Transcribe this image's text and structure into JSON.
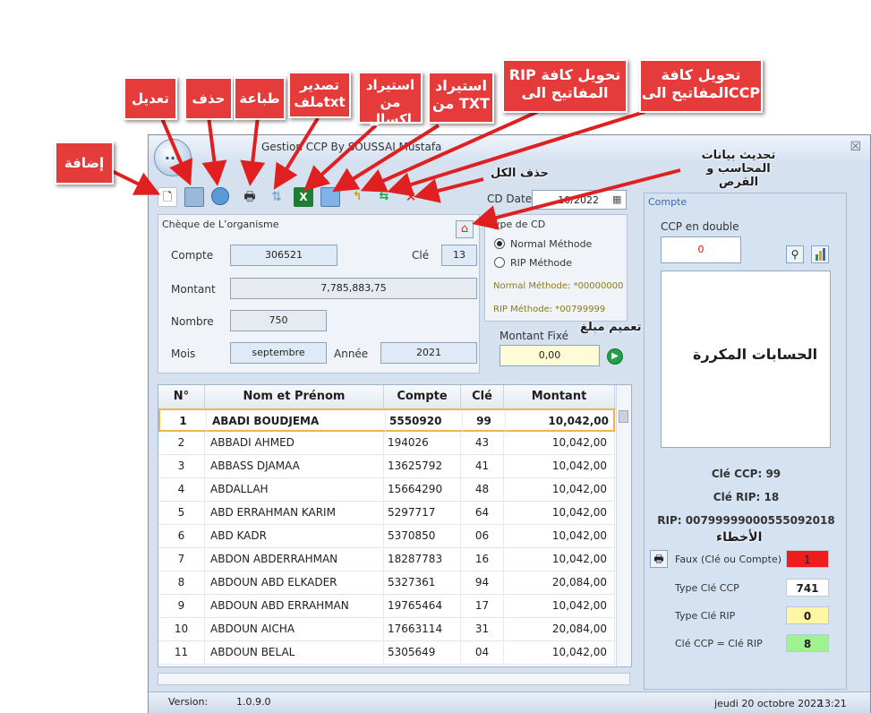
{
  "window": {
    "title": "Gestion CCP By SOUSSAI Mustafa",
    "orb_label": "...",
    "close_glyph": "☒"
  },
  "annotations": {
    "add": "إضافة",
    "edit": "تعديل",
    "delete": "حذف",
    "print": "طباعة",
    "export_txt": "تصدير ملفtxt",
    "import_excel": "استيراد من اكسال",
    "import_txt": "استيراد من TXT",
    "convert_rip": "RIP  تحويل كافة المفاتيح الى",
    "convert_ccp": "تحويل كافة المفاتيح الىCCP",
    "delete_all": "حذف الكل",
    "update_data": "تحديث بيانات المحاسب و القرص",
    "generalize_amount": "تعميم مبلغ",
    "duplicate_accounts": "الحسابات المكررة",
    "errors": "الأخطاء"
  },
  "toolbar": {
    "icons": [
      "new-document-icon",
      "edit-image-icon",
      "delete-icon",
      "print-icon",
      "export-txt-icon",
      "excel-icon",
      "import-txt-icon",
      "convert-rip-icon",
      "convert-ccp-icon",
      "delete-all-icon"
    ]
  },
  "cd_date": {
    "label": "CD Date",
    "value": "10/2022"
  },
  "cheque": {
    "section_title": "Chèque de L’organisme",
    "compte_label": "Compte",
    "compte_value": "306521",
    "cle_label": "Clé",
    "cle_value": "13",
    "montant_label": "Montant",
    "montant_value": "7,785,883,75",
    "nombre_label": "Nombre",
    "nombre_value": "750",
    "mois_label": "Mois",
    "mois_value": "septembre",
    "annee_label": "Année",
    "annee_value": "2021"
  },
  "type_cd": {
    "title": "Type de CD",
    "option_normal": "Normal Méthode",
    "option_rip": "RIP Méthode",
    "selected": "Normal Méthode",
    "normal_hint": "Normal Méthode: *00000000",
    "rip_hint": "RIP Méthode: *00799999"
  },
  "montant_fixe": {
    "label": "Montant Fixé",
    "value": "0,00"
  },
  "grid": {
    "columns": [
      "N°",
      "Nom et Prénom",
      "Compte",
      "Clé",
      "Montant"
    ],
    "rows": [
      {
        "n": "1",
        "nom": "ABADI BOUDJEMA",
        "compte": "5550920",
        "cle": "99",
        "montant": "10,042,00"
      },
      {
        "n": "2",
        "nom": "ABBADI AHMED",
        "compte": "194026",
        "cle": "43",
        "montant": "10,042,00"
      },
      {
        "n": "3",
        "nom": "ABBASS DJAMAA",
        "compte": "13625792",
        "cle": "41",
        "montant": "10,042,00"
      },
      {
        "n": "4",
        "nom": "ABDALLAH",
        "compte": "15664290",
        "cle": "48",
        "montant": "10,042,00"
      },
      {
        "n": "5",
        "nom": "ABD ERRAHMAN KARIM",
        "compte": "5297717",
        "cle": "64",
        "montant": "10,042,00"
      },
      {
        "n": "6",
        "nom": "ABD KADR",
        "compte": "5370850",
        "cle": "06",
        "montant": "10,042,00"
      },
      {
        "n": "7",
        "nom": "ABDON ABDERRAHMAN",
        "compte": "18287783",
        "cle": "16",
        "montant": "10,042,00"
      },
      {
        "n": "8",
        "nom": "ABDOUN ABD ELKADER",
        "compte": "5327361",
        "cle": "94",
        "montant": "20,084,00"
      },
      {
        "n": "9",
        "nom": "ABDOUN ABD ERRAHMAN",
        "compte": "19765464",
        "cle": "17",
        "montant": "10,042,00"
      },
      {
        "n": "10",
        "nom": "ABDOUN AICHA",
        "compte": "17663114",
        "cle": "31",
        "montant": "20,084,00"
      },
      {
        "n": "11",
        "nom": "ABDOUN BELAL",
        "compte": "5305649",
        "cle": "04",
        "montant": "10,042,00"
      }
    ]
  },
  "compte_panel": {
    "title": "Compte",
    "ccp_double_label": "CCP en double",
    "ccp_double_value": "0",
    "cle_ccp": "Clé CCP: 99",
    "cle_rip": "Clé RIP: 18",
    "rip": "RIP: 00799999000555092018",
    "faux_label": "Faux (Clé ou Compte)",
    "faux_value": "1",
    "type_ccp_label": "Type Clé CCP",
    "type_ccp_value": "741",
    "type_rip_label": "Type Clé RIP",
    "type_rip_value": "0",
    "cle_eq_label": "Clé CCP = Clé RIP",
    "cle_eq_value": "8"
  },
  "status": {
    "version_label": "Version:",
    "version_value": "1.0.9.0",
    "date": "jeudi 20 octobre 2022",
    "time": "13:21"
  },
  "colors": {
    "faux_box": "#ee1c1c",
    "type_ccp_box": "#ffffff",
    "type_rip_box": "#fdf7a5",
    "cle_eq_box": "#9ff28f",
    "annotation": "#e53b3b"
  }
}
